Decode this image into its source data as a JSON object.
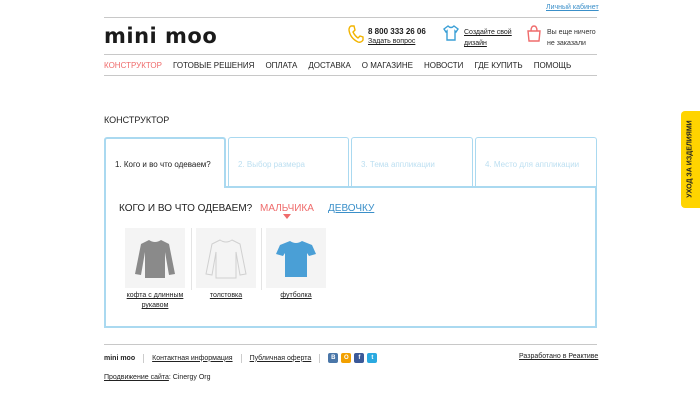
{
  "header": {
    "cabinet_link": "Личный кабинет",
    "logo": "mini moo",
    "phone": "8 800 333 26 06",
    "ask_link": "Задать вопрос",
    "create_design": "Создайте свой дизайн",
    "cart_text": "Вы еще ничего не заказали"
  },
  "nav": {
    "items": [
      {
        "label": "КОНСТРУКТОР",
        "active": true
      },
      {
        "label": "ГОТОВЫЕ РЕШЕНИЯ"
      },
      {
        "label": "ОПЛАТА"
      },
      {
        "label": "ДОСТАВКА"
      },
      {
        "label": "О МАГАЗИНЕ"
      },
      {
        "label": "НОВОСТИ"
      },
      {
        "label": "ГДЕ КУПИТЬ"
      },
      {
        "label": "ПОМОЩЬ"
      }
    ]
  },
  "main": {
    "title": "КОНСТРУКТОР",
    "tabs": [
      {
        "label": "1. Кого и во что одеваем?",
        "active": true
      },
      {
        "label": "2. Выбор размера"
      },
      {
        "label": "3. Тема аппликации"
      },
      {
        "label": "4. Место для аппликации"
      }
    ],
    "question": "КОГО И ВО ЧТО ОДЕВАЕМ?",
    "boy": "МАЛЬЧИКА",
    "girl": "ДЕВОЧКУ",
    "products": [
      {
        "name": "кофта с длинным рукавом",
        "color": "#8a8a8a"
      },
      {
        "name": "толстовка",
        "color": "#f2f2f2"
      },
      {
        "name": "футболка",
        "color": "#4a9fd6"
      }
    ]
  },
  "footer": {
    "brand": "mini moo",
    "contact": "Контактная информация",
    "offer": "Публичная оферта",
    "developer": "Разработано в Реактиве",
    "promo_link": "Продвижение сайта",
    "promo_text": ": Cinergy Org"
  },
  "side_tab": "УХОД ЗА ИЗДЕЛИЯМИ",
  "colors": {
    "accent_red": "#ef6c6c",
    "accent_blue": "#3a8fc9",
    "tab_border": "#aad9f0",
    "side_tab": "#ffd400"
  }
}
